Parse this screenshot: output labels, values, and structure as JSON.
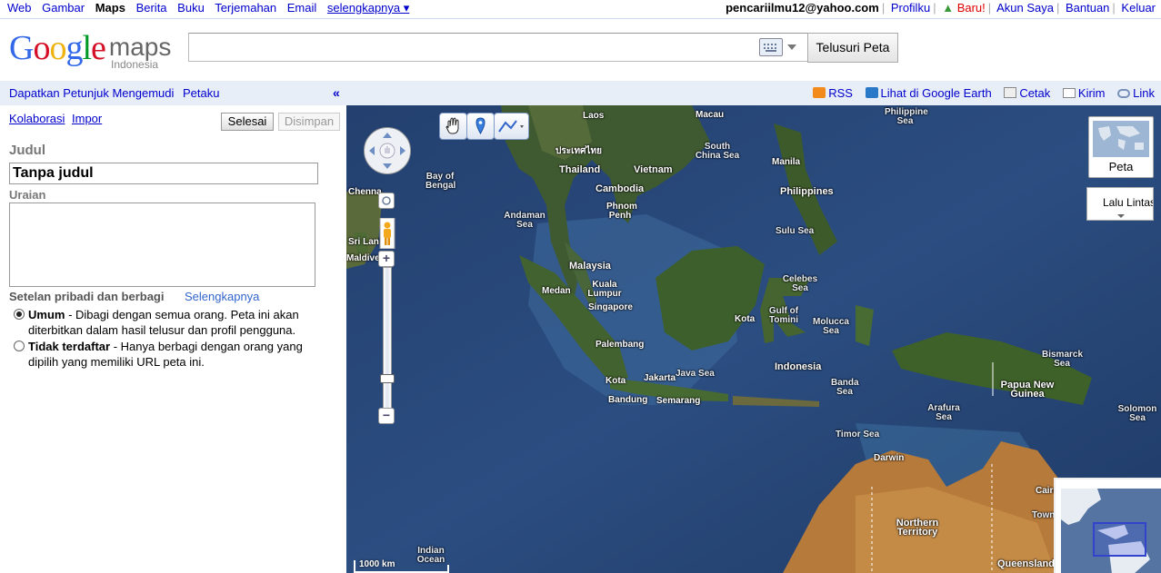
{
  "topbar": {
    "links": [
      "Web",
      "Gambar",
      "Maps",
      "Berita",
      "Buku",
      "Terjemahan",
      "Email"
    ],
    "current": "Maps",
    "more": "selengkapnya ▾",
    "email": "pencariilmu12@yahoo.com",
    "profilku": "Profilku",
    "baru": "Baru!",
    "akun": "Akun Saya",
    "bantuan": "Bantuan",
    "keluar": "Keluar"
  },
  "logo": {
    "google": "Google",
    "maps": "maps",
    "country": "Indonesia"
  },
  "search": {
    "value": "",
    "button": "Telusuri Peta"
  },
  "linkbar": {
    "directions": "Dapatkan Petunjuk Mengemudi",
    "mymaps": "Petaku",
    "collapse": "«",
    "rss": "RSS",
    "earth": "Lihat di Google Earth",
    "print": "Cetak",
    "send": "Kirim",
    "link": "Link"
  },
  "editor": {
    "kolaborasi": "Kolaborasi",
    "impor": "Impor",
    "selesai": "Selesai",
    "disimpan": "Disimpan",
    "judul_label": "Judul",
    "judul_value": "Tanpa judul",
    "uraian_label": "Uraian",
    "uraian_value": "",
    "privacy_label": "Setelan pribadi dan berbagi",
    "privacy_more": "Selengkapnya",
    "opt_public_title": "Umum",
    "opt_public_desc": " - Dibagi dengan semua orang. Peta ini akan diterbitkan dalam hasil telusur dan profil pengguna.",
    "opt_unlisted_title": "Tidak terdaftar",
    "opt_unlisted_desc": " - Hanya berbagi dengan orang yang dipilih yang memiliki URL peta ini.",
    "selected": "Umum"
  },
  "map": {
    "map_type": "Peta",
    "traffic": "Lalu Lintas",
    "scale": "1000 km",
    "labels": {
      "laos": "Laos",
      "macau": "Macau",
      "philippine_sea": "Philippine Sea",
      "thailand_script": "ประเทศไทย",
      "thailand": "Thailand",
      "vietnam": "Vietnam",
      "south_china_sea": "South China Sea",
      "manila": "Manila",
      "bay_bengal": "Bay of Bengal",
      "cambodia": "Cambodia",
      "phnom": "Phnom Penh",
      "philippines": "Philippines",
      "chenna": "Chenna",
      "andaman": "Andaman Sea",
      "sulu": "Sulu Sea",
      "srilanka": "Sri Lanka",
      "malaysia": "Malaysia",
      "medan": "Medan",
      "kuala": "Kuala Lumpur",
      "celebes": "Celebes Sea",
      "singapore": "Singapore",
      "gulf_tomini": "Gulf of Tomini",
      "kota": "Kota",
      "molucca": "Molucca Sea",
      "palembang": "Palembang",
      "indonesia": "Indonesia",
      "bismarck": "Bismarck Sea",
      "jakarta": "Jakarta",
      "java_sea": "Java Sea",
      "papua": "Papua New Guinea",
      "banda": "Banda Sea",
      "kota2": "Kota",
      "bandung": "Bandung",
      "semarang": "Semarang",
      "arafura": "Arafura Sea",
      "solomon": "Solomon Sea",
      "timor": "Timor Sea",
      "darwin": "Darwin",
      "cairns": "Cairns",
      "northern": "Northern Territory",
      "indian": "Indian Ocean",
      "queensland": "Queensland",
      "maldives": "Maldives",
      "townsville": "Townsville"
    }
  }
}
